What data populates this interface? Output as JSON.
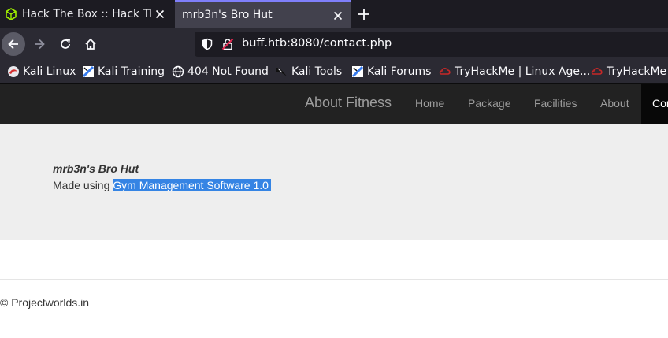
{
  "browser": {
    "tabs": [
      {
        "title": "Hack The Box :: Hack The Box",
        "active": false,
        "favicon": "htb-cube-icon"
      },
      {
        "title": "mrb3n's Bro Hut",
        "active": true
      }
    ],
    "url": "buff.htb:8080/contact.php",
    "bookmarks": [
      {
        "label": "Kali Linux",
        "icon": "kali-dragon-icon"
      },
      {
        "label": "Kali Training",
        "icon": "kali-training-icon"
      },
      {
        "label": "404 Not Found",
        "icon": "globe-icon"
      },
      {
        "label": "Kali Tools",
        "icon": "kali-tools-icon"
      },
      {
        "label": "Kali Forums",
        "icon": "kali-forums-icon"
      },
      {
        "label": "TryHackMe | Linux Age...",
        "icon": "tryhackme-icon"
      },
      {
        "label": "TryHackMe",
        "icon": "tryhackme-icon"
      }
    ],
    "colors": {
      "tabbar": "#1c1b22",
      "toolbar": "#2b2a33",
      "active_tab": "#42414d",
      "accent": "#7f7ffa"
    }
  },
  "site": {
    "brand": "About Fitness",
    "menu": [
      "Home",
      "Package",
      "Facilities",
      "About"
    ],
    "active_menu": "Con",
    "hero": {
      "title": "mrb3n's Bro Hut",
      "made_using": "Made using",
      "software": "Gym Management Software 1.0"
    },
    "footer": "© Projectworlds.in",
    "colors": {
      "header": "#222222",
      "hero": "#eeeeee",
      "selection": "#3584e4"
    }
  }
}
